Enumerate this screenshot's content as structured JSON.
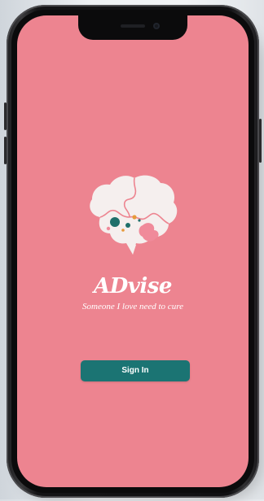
{
  "app": {
    "name": "ADvise",
    "tagline": "Someone I love need to cure"
  },
  "signin": {
    "label": "Sign In"
  },
  "colors": {
    "screen_background": "#ed8490",
    "button": "#1b7473",
    "text": "#ffffff",
    "logo_brain": "#f5efee",
    "logo_accent_teal": "#1f6f6a",
    "logo_accent_orange": "#e69a3a",
    "logo_accent_pink": "#f08a9a"
  },
  "icons": {
    "logo": "brain-puzzle-icon",
    "camera": "front-camera-icon",
    "speaker": "earpiece-speaker-icon"
  }
}
